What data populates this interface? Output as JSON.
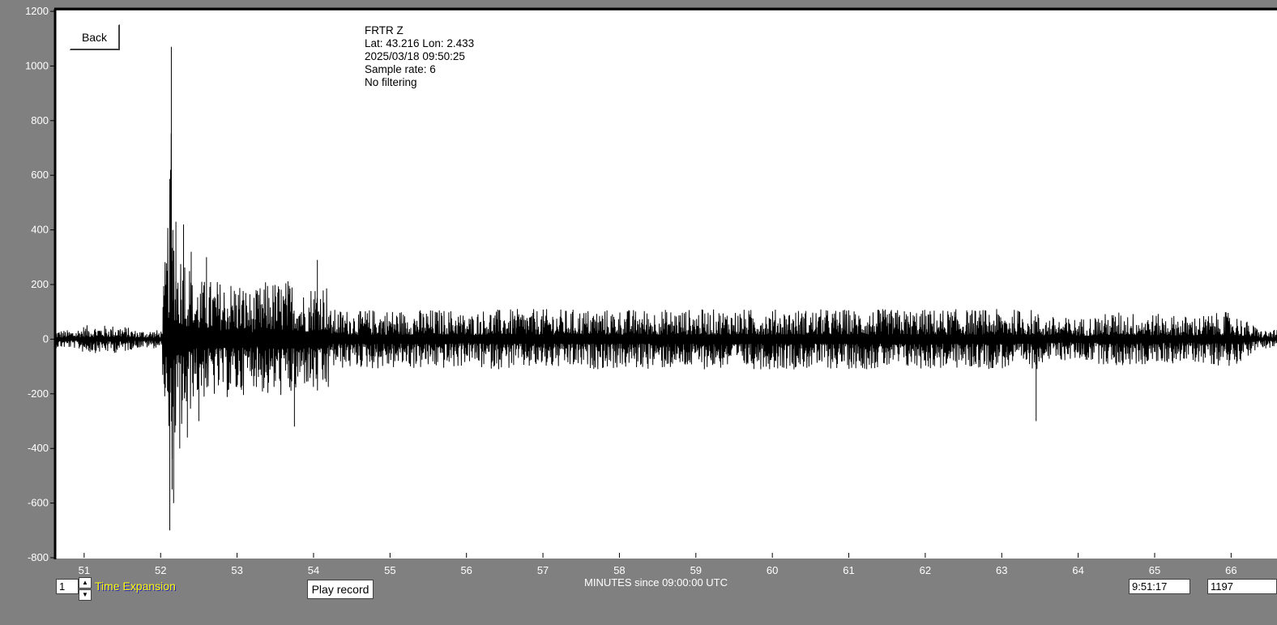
{
  "station": {
    "name": "FRTR  Z",
    "location": "Lat: 43.216 Lon: 2.433",
    "datetime": "2025/03/18 09:50:25",
    "sample_rate": "Sample rate: 6",
    "filter": "No filtering"
  },
  "buttons": {
    "back": "Back",
    "play": "Play record"
  },
  "controls": {
    "time_expansion_value": "1",
    "time_expansion_label": "Time Expansion",
    "up_icon": "triangle-up-icon",
    "down_icon": "triangle-down-icon",
    "time_readout": "9:51:17",
    "sample_count": "1197"
  },
  "colors": {
    "background": "#808080",
    "plot": "#ffffff",
    "trace": "#000000",
    "label_yellow": "#ffff00"
  },
  "chart_data": {
    "type": "line",
    "xlabel": "MINUTES since 09:00:00 UTC",
    "ylabel": "",
    "xlim": [
      50.62,
      66.6
    ],
    "ylim": [
      -800,
      1200
    ],
    "xticks": [
      "51",
      "52",
      "53",
      "54",
      "55",
      "56",
      "57",
      "58",
      "59",
      "60",
      "61",
      "62",
      "63",
      "64",
      "65",
      "66"
    ],
    "yticks": [
      "1200",
      "1000",
      "800",
      "600",
      "400",
      "200",
      "0",
      "-200",
      "-400",
      "-600",
      "-800"
    ],
    "grid": false,
    "legend": "none",
    "series": [
      {
        "x": [
          50.62,
          51,
          51.5,
          52,
          52.12,
          52.13,
          52.14,
          52.15,
          52.16,
          52.17,
          52.2,
          52.25,
          52.3,
          52.35,
          52.4,
          52.5,
          52.6,
          52.8,
          53,
          53.2,
          53.4,
          53.6,
          53.75,
          53.8,
          53.9,
          54.05,
          54.3,
          54.6,
          54.9,
          55.2,
          55.5,
          56,
          56.5,
          57,
          58,
          59,
          60,
          61,
          62,
          63,
          63.45,
          63.47,
          63.5,
          63.6,
          64,
          64.5,
          65,
          65.5,
          66,
          66.6
        ],
        "values": [
          0,
          60,
          -60,
          0,
          -700,
          620,
          1070,
          -550,
          400,
          -600,
          430,
          -400,
          420,
          -360,
          320,
          -300,
          300,
          -250,
          270,
          -200,
          260,
          -250,
          -320,
          240,
          -200,
          290,
          -200,
          120,
          -210,
          110,
          -240,
          100,
          -180,
          150,
          -150,
          140,
          -160,
          150,
          -140,
          140,
          -300,
          120,
          -100,
          100,
          -90,
          120,
          -110,
          100,
          -120,
          0
        ]
      }
    ]
  }
}
